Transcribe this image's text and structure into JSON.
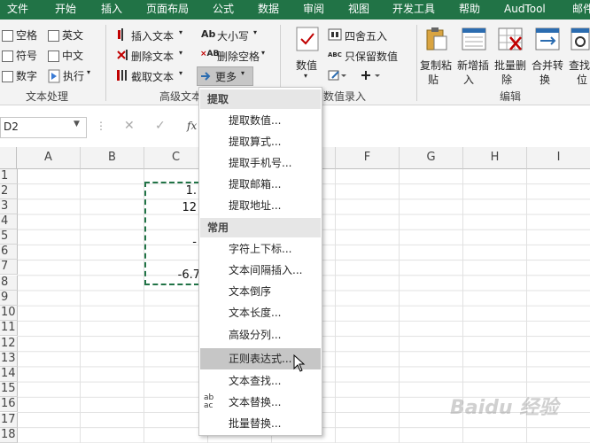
{
  "menu_bar": [
    "文件",
    "开始",
    "插入",
    "页面布局",
    "公式",
    "数据",
    "审阅",
    "视图",
    "开发工具",
    "帮助",
    "AudTool",
    "邮件"
  ],
  "ribbon": {
    "text_group": {
      "label": "文本处理",
      "checkboxes": [
        "空格",
        "英文",
        "符号",
        "中文",
        "数字"
      ],
      "exec": "执行"
    },
    "advanced_group": {
      "label": "高级文本",
      "insert_text": "插入文本",
      "delete_text": "删除文本",
      "extract_text": "截取文本",
      "case": "大小写",
      "delete_spaces": "删除空格",
      "more": "更多",
      "ico_case": "Ab",
      "ico_space": "AB"
    },
    "number_group": {
      "label": "数值录入",
      "value": "数值",
      "round": "四舍五入",
      "keep_value": "只保留数值",
      "abc": "ABC"
    },
    "edit_group": {
      "label": "编辑",
      "buttons": [
        "复制粘贴",
        "新增插入",
        "批量删除",
        "合并转换",
        "查找定位"
      ],
      "lines1": [
        "复制粘",
        "新增插",
        "批量删",
        "合并转",
        "查找"
      ],
      "lines2": [
        "贴",
        "入",
        "除",
        "换",
        "位"
      ]
    }
  },
  "formula_bar": {
    "name_box": "D2",
    "fx": "fx"
  },
  "columns": [
    "A",
    "B",
    "C",
    "",
    "",
    "F",
    "G",
    "H",
    "I"
  ],
  "rows": [
    "1",
    "2",
    "3",
    "4",
    "5",
    "6",
    "7",
    "8",
    "9",
    "10",
    "11",
    "12",
    "13",
    "14",
    "15",
    "16",
    "17",
    "18"
  ],
  "cells": {
    "c2": "1.",
    "c3": "12",
    "c5": "-",
    "c7": "-6.7"
  },
  "dropdown": {
    "sections": [
      {
        "header": "提取",
        "items": [
          "提取数值...",
          "提取算式...",
          "提取手机号...",
          "提取邮箱...",
          "提取地址..."
        ]
      },
      {
        "header": "常用",
        "items": [
          "字符上下标...",
          "文本间隔插入...",
          "文本倒序",
          "文本长度...",
          "高级分列...",
          "正则表达式...",
          "文本查找...",
          "文本替换...",
          "批量替换..."
        ]
      }
    ],
    "highlighted": "正则表达式...",
    "replace_icon": "ab ac"
  },
  "watermark": "Baidu 经验"
}
